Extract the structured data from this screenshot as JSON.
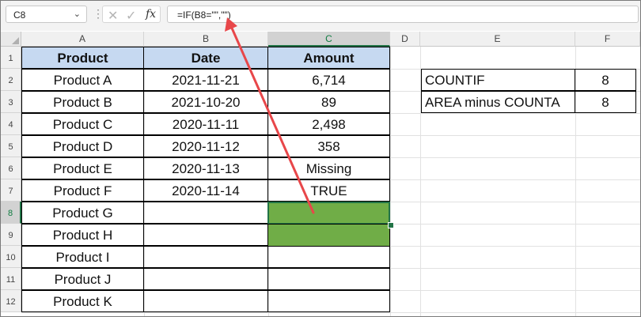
{
  "formula_bar": {
    "name_box": "C8",
    "name_box_arrow": "⌄",
    "dots": "⋮",
    "cancel_icon": "✕",
    "enter_icon": "✓",
    "fx_label": "fx",
    "formula": "=IF(B8=\"\",\"\")"
  },
  "columns": [
    "A",
    "B",
    "C",
    "D",
    "E",
    "F"
  ],
  "rows": [
    "1",
    "2",
    "3",
    "4",
    "5",
    "6",
    "7",
    "8",
    "9",
    "10",
    "11",
    "12"
  ],
  "table": {
    "headers": [
      "Product",
      "Date",
      "Amount"
    ],
    "products": [
      "Product A",
      "Product B",
      "Product C",
      "Product D",
      "Product E",
      "Product F",
      "Product G",
      "Product H",
      "Product I",
      "Product J",
      "Product K"
    ],
    "dates": [
      "2021-11-21",
      "2021-10-20",
      "2020-11-11",
      "2020-11-12",
      "2020-11-13",
      "2020-11-14"
    ],
    "amounts": [
      "6,714",
      "89",
      "2,498",
      "358",
      "Missing",
      "TRUE"
    ]
  },
  "side_table": {
    "countif_label": "COUNTIF",
    "countif_value": "8",
    "area_label": "AREA minus COUNTA",
    "area_value": "8"
  },
  "colors": {
    "header_fill": "#c6d9f1",
    "highlight_fill": "#70ad47",
    "selection": "#217346",
    "arrow": "#e8474a"
  }
}
